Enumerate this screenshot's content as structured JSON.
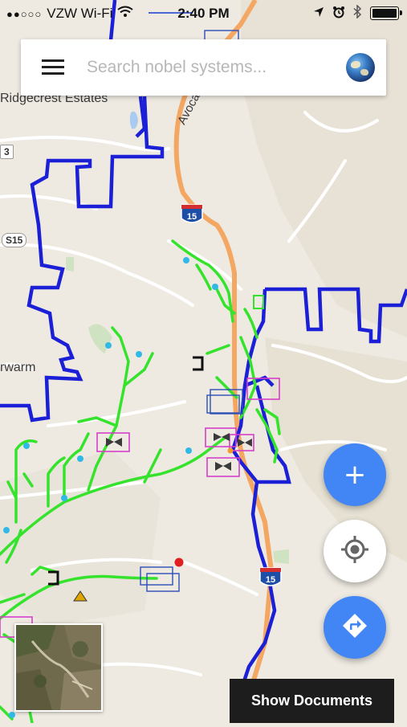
{
  "status_bar": {
    "signal": "●●○○○",
    "carrier": "VZW Wi-Fi",
    "wifi_icon": "wifi-icon",
    "time": "2:40 PM",
    "icons": [
      "location-arrow-icon",
      "alarm-clock-icon",
      "bluetooth-icon",
      "battery-icon"
    ]
  },
  "search": {
    "placeholder": "Search nobel systems...",
    "value": ""
  },
  "map": {
    "place_labels": {
      "ridgecrest": "Ridgecrest Estates",
      "warm": "rwarm",
      "avocado": "Avocad",
      "s15": "S15",
      "route3": "3"
    },
    "highway_shield": "15",
    "colors": {
      "boundary": "#1b1fd6",
      "pipeline": "#35e22c",
      "highway": "#f3a762",
      "feature_box": "#d640c9"
    }
  },
  "buttons": {
    "add": "+",
    "locate_icon": "crosshair-icon",
    "directions_icon": "directions-icon"
  },
  "show_documents": "Show Documents"
}
